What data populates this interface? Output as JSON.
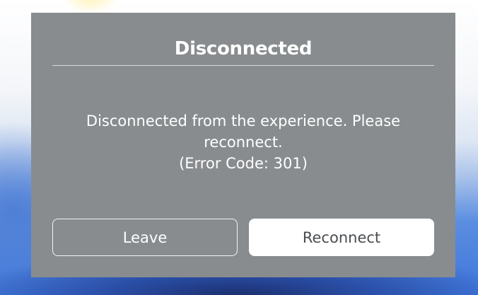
{
  "dialog": {
    "title": "Disconnected",
    "message_line1": "Disconnected from the experience. Please",
    "message_line2": "reconnect.",
    "message_line3": "(Error Code: 301)",
    "leave_label": "Leave",
    "reconnect_label": "Reconnect"
  },
  "colors": {
    "dialog_background": "#888c8f",
    "text": "#ffffff",
    "reconnect_button_background": "#ffffff",
    "reconnect_button_text": "#4a4d50"
  }
}
